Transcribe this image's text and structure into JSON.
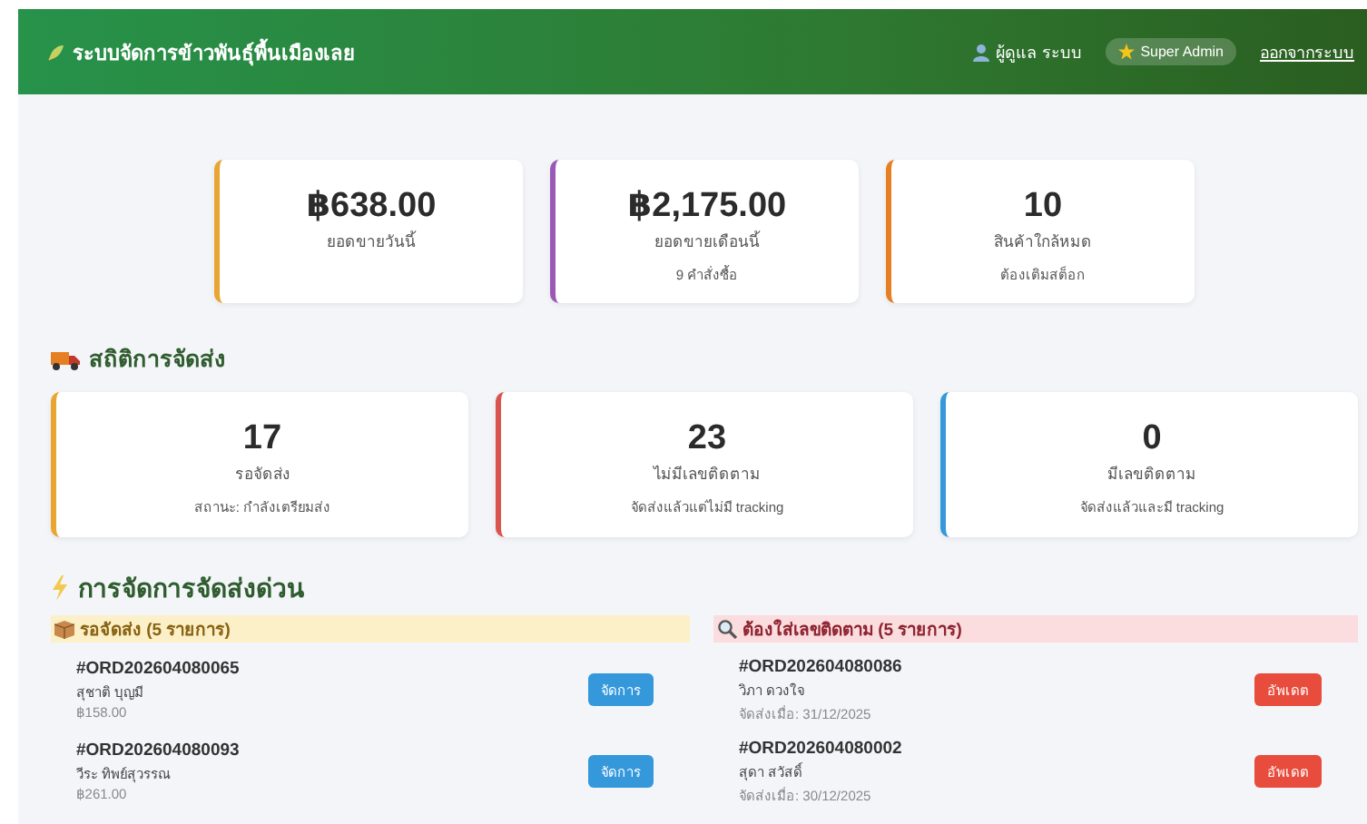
{
  "header": {
    "title": "ระบบจัดการข้าวพันธุ์พื้นเมืองเลย",
    "user": "ผู้ดูแล ระบบ",
    "role_badge": "Super Admin",
    "logout": "ออกจากระบบ"
  },
  "summary_cards": [
    {
      "value": "฿638.00",
      "label": "ยอดขายวันนี้",
      "color": "#e8a531"
    },
    {
      "value": "฿2,175.00",
      "label": "ยอดขายเดือนนี้",
      "note": "9 คำสั่งซื้อ",
      "color": "#9b59b6"
    },
    {
      "value": "10",
      "label": "สินค้าใกล้หมด",
      "note": "ต้องเติมสต็อก",
      "color": "#e67e22"
    }
  ],
  "shipping_stats": {
    "title": "สถิติการจัดส่ง",
    "cards": [
      {
        "value": "17",
        "label": "รอจัดส่ง",
        "note": "สถานะ: กำลังเตรียมส่ง",
        "color": "#e8a531"
      },
      {
        "value": "23",
        "label": "ไม่มีเลขติดตาม",
        "note": "จัดส่งแล้วแต่ไม่มี tracking",
        "color": "#d9534f"
      },
      {
        "value": "0",
        "label": "มีเลขติดตาม",
        "note": "จัดส่งแล้วและมี tracking",
        "color": "#3498db"
      }
    ]
  },
  "urgent": {
    "title": "การจัดการจัดส่งด่วน",
    "columns": [
      {
        "kind": "pending",
        "title": "รอจัดส่ง (5 รายการ)",
        "items": [
          {
            "order": "#ORD202604080065",
            "name": "สุชาติ บุญมี",
            "detail": "฿158.00",
            "action": "จัดการ"
          },
          {
            "order": "#ORD202604080093",
            "name": "วีระ ทิพย์สุวรรณ",
            "detail": "฿261.00",
            "action": "จัดการ"
          }
        ]
      },
      {
        "kind": "tracking",
        "title": "ต้องใส่เลขติดตาม (5 รายการ)",
        "items": [
          {
            "order": "#ORD202604080086",
            "name": "วิภา ดวงใจ",
            "detail": "จัดส่งเมื่อ: 31/12/2025",
            "action": "อัพเดต"
          },
          {
            "order": "#ORD202604080002",
            "name": "สุดา สวัสดิ์",
            "detail": "จัดส่งเมื่อ: 30/12/2025",
            "action": "อัพเดต"
          }
        ]
      }
    ]
  }
}
